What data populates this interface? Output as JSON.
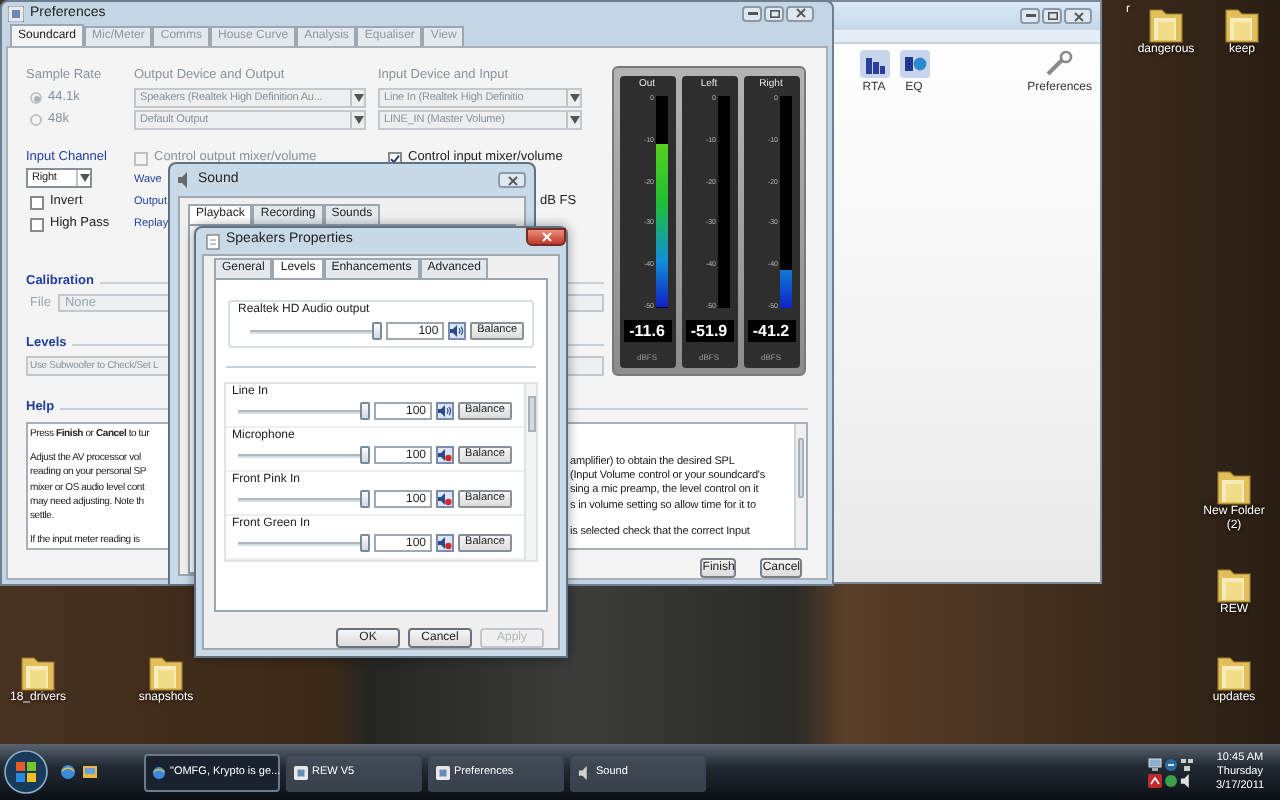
{
  "preferences_window": {
    "title": "Preferences",
    "tabs": [
      {
        "label": "Soundcard",
        "selected": true,
        "disabled": false
      },
      {
        "label": "Mic/Meter",
        "selected": false,
        "disabled": true
      },
      {
        "label": "Comms",
        "selected": false,
        "disabled": true
      },
      {
        "label": "House Curve",
        "selected": false,
        "disabled": true
      },
      {
        "label": "Analysis",
        "selected": false,
        "disabled": true
      },
      {
        "label": "Equaliser",
        "selected": false,
        "disabled": true
      },
      {
        "label": "View",
        "selected": false,
        "disabled": true
      }
    ],
    "sample_rate": {
      "label": "Sample Rate",
      "disabled": true,
      "options": [
        {
          "label": "44.1k",
          "selected": true
        },
        {
          "label": "48k",
          "selected": false
        }
      ]
    },
    "output_device": {
      "label": "Output Device and Output",
      "disabled": true,
      "fields": [
        "Speakers (Realtek High Definition Au...",
        "Default Output"
      ]
    },
    "input_device": {
      "label": "Input Device and Input",
      "disabled": true,
      "fields": [
        "Line In (Realtek High Definitio",
        "LINE_IN (Master Volume)"
      ]
    },
    "input_channel": {
      "label": "Input Channel",
      "value": "Right"
    },
    "channel_options": [
      {
        "label": "Invert",
        "checked": false
      },
      {
        "label": "High Pass",
        "checked": false
      }
    ],
    "mixer_options": [
      {
        "label": "Control output mixer/volume",
        "checked": false,
        "disabled": true
      },
      {
        "label": "Control input mixer/volume",
        "checked": true,
        "disabled": false
      }
    ],
    "side_labels": [
      "Wave",
      "Output",
      "Replay"
    ],
    "level_unit": "dB FS",
    "calibration": {
      "label": "Calibration",
      "file_label": "File",
      "file_value": "None"
    },
    "levels": {
      "label": "Levels",
      "button": "Use Subwoofer to Check/Set L"
    },
    "meters": [
      {
        "name": "Out",
        "scale": [
          "0",
          "-10",
          "-20",
          "-30",
          "-40",
          "-50"
        ],
        "level": 0.77,
        "reading": "-11.6",
        "unit": "dBFS"
      },
      {
        "name": "Left",
        "scale": [
          "0",
          "-10",
          "-20",
          "-30",
          "-40",
          "-50"
        ],
        "level": 0,
        "reading": "-51.9",
        "unit": "dBFS"
      },
      {
        "name": "Right",
        "scale": [
          "0",
          "-10",
          "-20",
          "-30",
          "-40",
          "-50"
        ],
        "level": 0.18,
        "reading": "-41.2",
        "unit": "dBFS"
      }
    ],
    "help": {
      "label": "Help",
      "left_lines": [
        "Press **Finish** or **Cancel** to tur",
        "Adjust the AV processor vol",
        "reading on your personal SP",
        "mixer or OS audio level cont",
        "may need adjusting. Note th",
        "settle.",
        "If the input meter reading is"
      ],
      "right_lines": [
        "amplifier) to obtain the desired SPL",
        "(Input Volume control or your soundcard's",
        "sing a mic preamp, the level control on it",
        "s in volume setting so allow time for it to",
        "is selected check that the correct Input"
      ]
    },
    "buttons": [
      "Finish",
      "Cancel"
    ]
  },
  "rew_window": {
    "tools": [
      {
        "kind": "rta",
        "label": "RTA"
      },
      {
        "kind": "eq",
        "label": "EQ"
      },
      {
        "kind": "preferences",
        "label": "Preferences"
      }
    ]
  },
  "sound_window": {
    "title": "Sound",
    "tabs": [
      {
        "label": "Playback",
        "selected": true
      },
      {
        "label": "Recording",
        "selected": false
      },
      {
        "label": "Sounds",
        "selected": false
      }
    ]
  },
  "speakers_properties": {
    "title": "Speakers Properties",
    "tabs": [
      {
        "label": "General",
        "selected": false
      },
      {
        "label": "Levels",
        "selected": true
      },
      {
        "label": "Enhancements",
        "selected": false
      },
      {
        "label": "Advanced",
        "selected": false
      }
    ],
    "master": {
      "label": "Realtek HD Audio output",
      "level": 1,
      "value": "100",
      "muted": false,
      "button": "Balance"
    },
    "channels": [
      {
        "label": "Line In",
        "level": 1,
        "value": "100",
        "muted": false,
        "button": "Balance"
      },
      {
        "label": "Microphone",
        "level": 1,
        "value": "100",
        "muted": true,
        "button": "Balance"
      },
      {
        "label": "Front Pink In",
        "level": 1,
        "value": "100",
        "muted": true,
        "button": "Balance"
      },
      {
        "label": "Front Green In",
        "level": 1,
        "value": "100",
        "muted": true,
        "button": "Balance"
      }
    ],
    "buttons": [
      {
        "label": "OK",
        "disabled": false
      },
      {
        "label": "Cancel",
        "disabled": false
      },
      {
        "label": "Apply",
        "disabled": true
      }
    ]
  },
  "desktop_icons": [
    {
      "label": "r"
    },
    {
      "label": "dangerous"
    },
    {
      "label": "keep"
    },
    {
      "label": "New Folder (2)"
    },
    {
      "label": "REW"
    },
    {
      "label": "18_drivers"
    },
    {
      "label": "snapshots"
    },
    {
      "label": "updates"
    }
  ],
  "taskbar": {
    "tasks": [
      {
        "kind": "browser",
        "label": "\"OMFG, Krypto is ge...",
        "selected": true
      },
      {
        "kind": "app",
        "label": "REW V5",
        "selected": false
      },
      {
        "kind": "app",
        "label": "Preferences",
        "selected": false
      },
      {
        "kind": "sound",
        "label": "Sound",
        "selected": false
      }
    ],
    "clock": {
      "time": "10:45 AM",
      "day": "Thursday",
      "date": "3/17/2011"
    }
  }
}
